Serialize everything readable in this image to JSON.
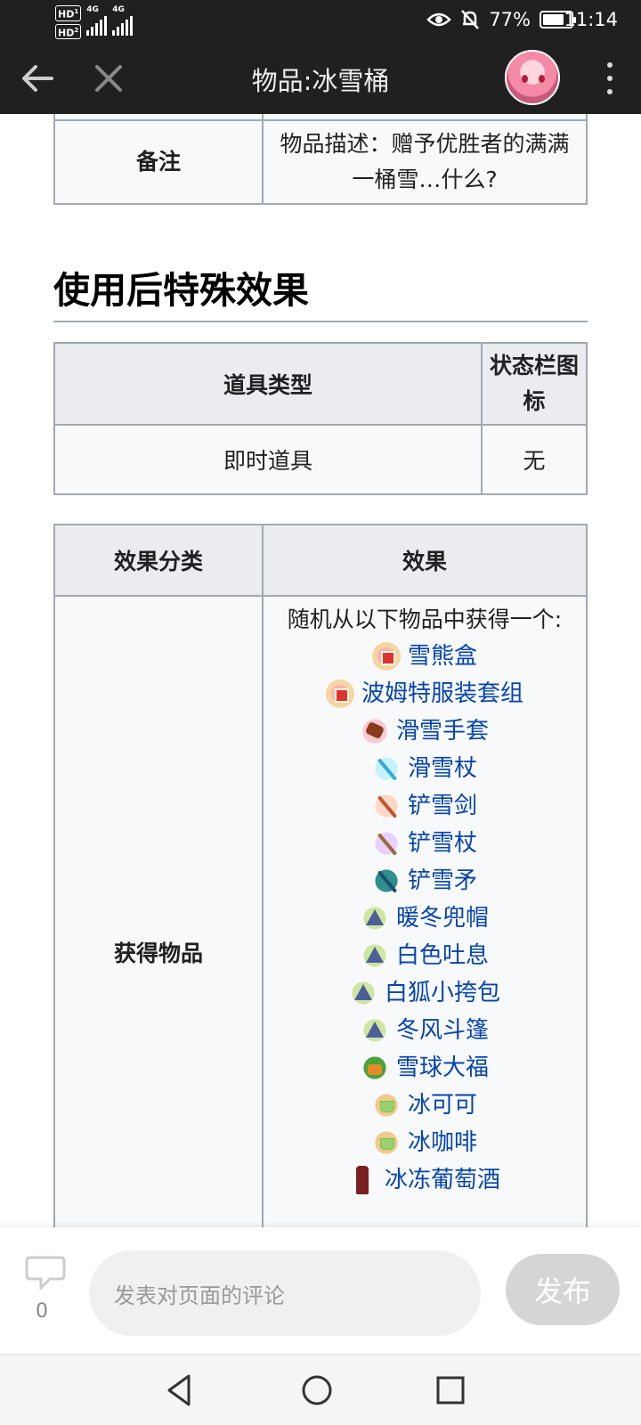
{
  "status_bar": {
    "sim1": "HD",
    "sim1_index": "1",
    "sim2": "HD",
    "sim2_index": "2",
    "net1": "4G",
    "net2": "4G",
    "battery_pct": "77%",
    "battery_level": 0.77,
    "time": "11:14"
  },
  "app_bar": {
    "title": "物品:冰雪桶",
    "back_icon": "arrow-left-icon",
    "close_icon": "close-icon",
    "menu_icon": "more-vert-icon"
  },
  "top_table": {
    "label": "备注",
    "value": "物品描述：赠予优胜者的满满一桶雪…什么?"
  },
  "section": {
    "title": "使用后特殊效果"
  },
  "type_table": {
    "headers": [
      "道具类型",
      "状态栏图标"
    ],
    "row": [
      "即时道具",
      "无"
    ]
  },
  "effect_table": {
    "headers": [
      "效果分类",
      "效果"
    ],
    "category": "获得物品",
    "intro": "随机从以下物品中获得一个:",
    "items": [
      {
        "name": "雪熊盒",
        "icon": "gift-box-icon"
      },
      {
        "name": "波姆特服装套组",
        "icon": "gift-box-icon"
      },
      {
        "name": "滑雪手套",
        "icon": "glove-icon"
      },
      {
        "name": "滑雪杖",
        "icon": "ski-pole-icon"
      },
      {
        "name": "铲雪剑",
        "icon": "sword-icon"
      },
      {
        "name": "铲雪杖",
        "icon": "staff-icon"
      },
      {
        "name": "铲雪矛",
        "icon": "spear-icon"
      },
      {
        "name": "暖冬兜帽",
        "icon": "hat-icon"
      },
      {
        "name": "白色吐息",
        "icon": "hat-icon"
      },
      {
        "name": "白狐小挎包",
        "icon": "hat-icon"
      },
      {
        "name": "冬风斗篷",
        "icon": "hat-icon"
      },
      {
        "name": "雪球大福",
        "icon": "pot-icon"
      },
      {
        "name": "冰可可",
        "icon": "cup-icon"
      },
      {
        "name": "冰咖啡",
        "icon": "cup-icon"
      },
      {
        "name": "冰冻葡萄酒",
        "icon": "wine-icon"
      }
    ]
  },
  "comment_bar": {
    "count": "0",
    "placeholder": "发表对页面的评论",
    "post_label": "发布"
  },
  "colors": {
    "link": "#0645ad",
    "header_bg": "#eaecf0",
    "cell_bg": "#f8f9fa",
    "border": "#a2a9b1",
    "topbar": "#202020"
  }
}
